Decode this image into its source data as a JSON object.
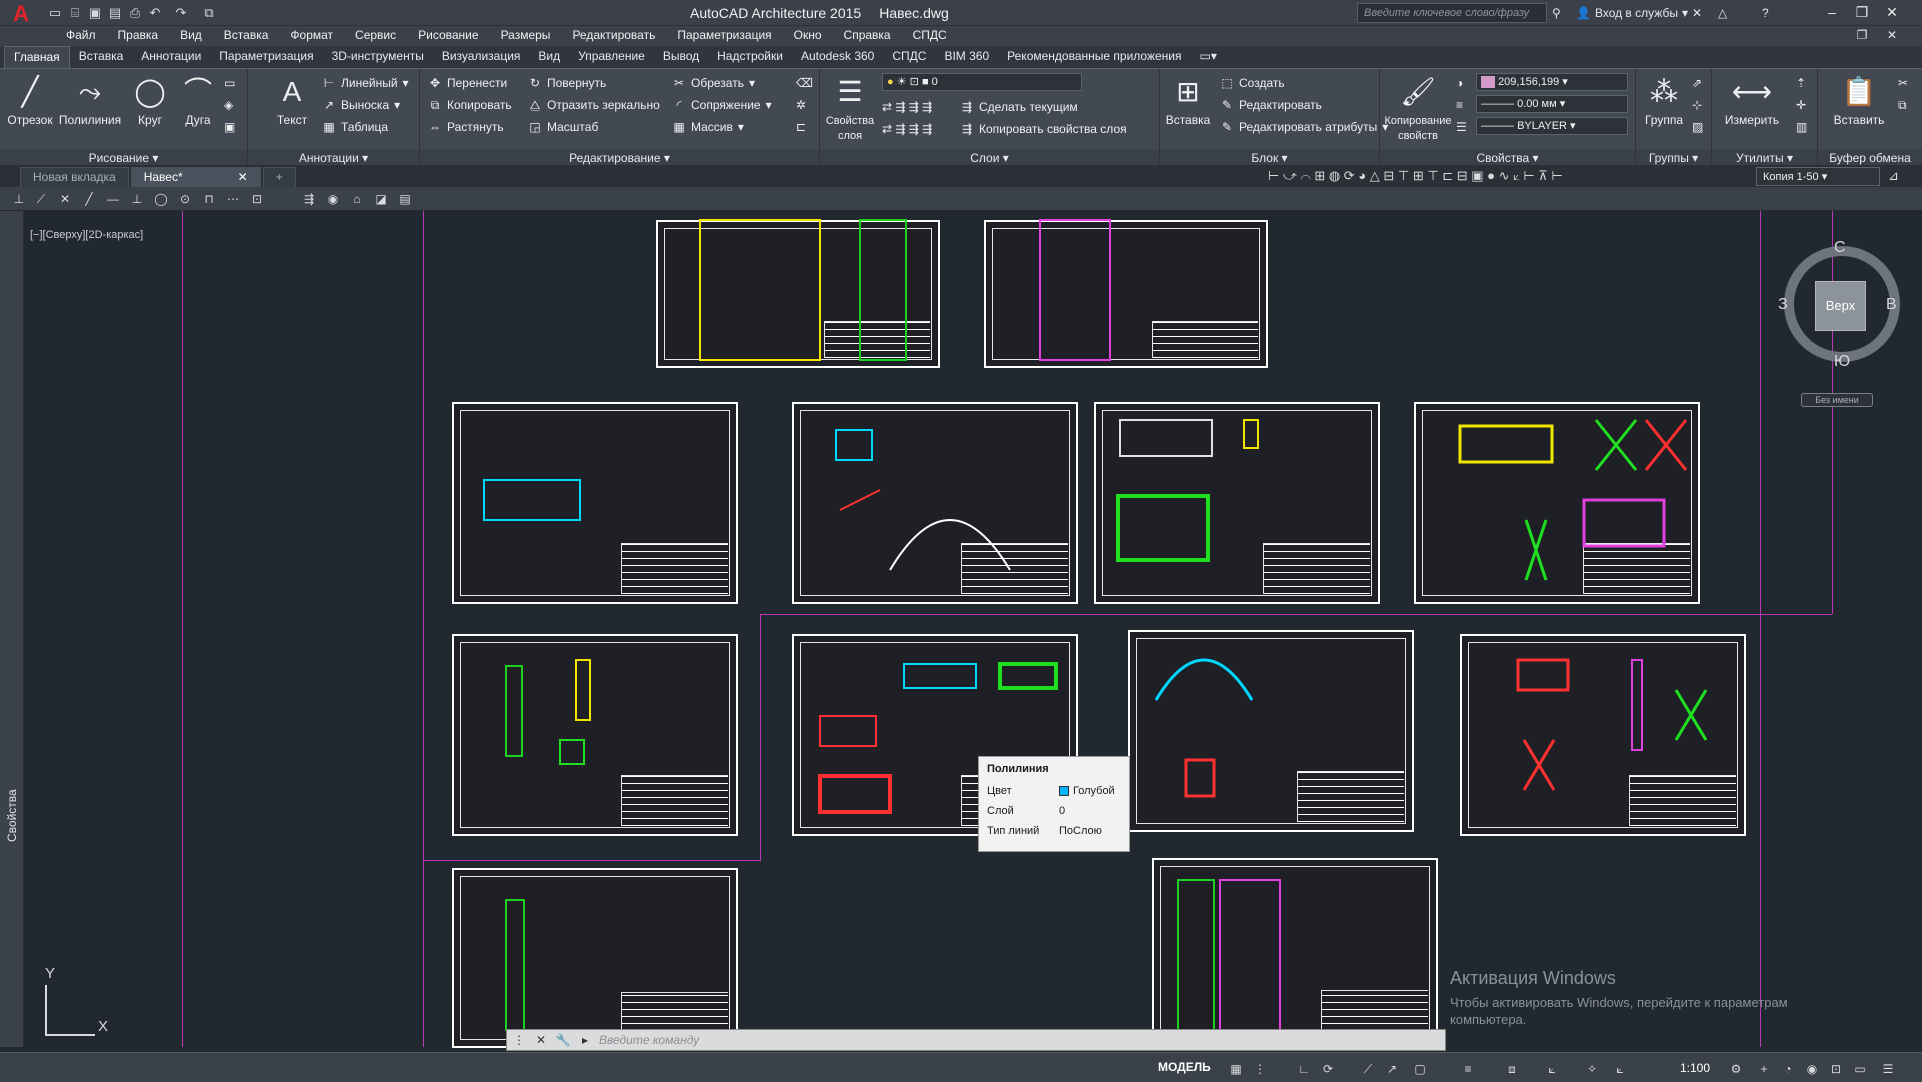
{
  "titlebar": {
    "app_title": "AutoCAD Architecture 2015",
    "file_name": "Навес.dwg",
    "search_placeholder": "Введите ключевое слово/фразу",
    "signin": "Вход в службы"
  },
  "menu": [
    "Файл",
    "Правка",
    "Вид",
    "Вставка",
    "Формат",
    "Сервис",
    "Рисование",
    "Размеры",
    "Редактировать",
    "Параметризация",
    "Окно",
    "Справка",
    "СПДС"
  ],
  "ribbon_tabs": [
    "Главная",
    "Вставка",
    "Аннотации",
    "Параметризация",
    "3D-инструменты",
    "Визуализация",
    "Вид",
    "Управление",
    "Вывод",
    "Надстройки",
    "Autodesk 360",
    "СПДС",
    "BIM 360",
    "Рекомендованные приложения"
  ],
  "ribbon": {
    "draw": {
      "title": "Рисование",
      "line": "Отрезок",
      "polyline": "Полилиния",
      "circle": "Круг",
      "arc": "Дуга"
    },
    "annotation": {
      "title": "Аннотации",
      "text": "Текст",
      "linear": "Линейный",
      "leader": "Выноска",
      "table": "Таблица"
    },
    "modify": {
      "title": "Редактирование",
      "move": "Перенести",
      "rotate": "Повернуть",
      "trim": "Обрезать",
      "copy": "Копировать",
      "mirror": "Отразить зеркально",
      "fillet": "Сопряжение",
      "stretch": "Растянуть",
      "scale": "Масштаб",
      "array": "Массив"
    },
    "layers": {
      "title": "Слои",
      "props": "Свойства слоя",
      "current_layer": "0",
      "make_current": "Сделать текущим",
      "copy_props": "Копировать свойства слоя"
    },
    "block": {
      "title": "Блок",
      "insert": "Вставка",
      "create": "Создать",
      "edit": "Редактировать",
      "edit_attr": "Редактировать атрибуты"
    },
    "properties": {
      "title": "Свойства",
      "match": "Копирование свойств",
      "color": "209,156,199",
      "lineweight": "0.00 мм",
      "linetype": "BYLAYER"
    },
    "groups": {
      "title": "Группы",
      "group": "Группа"
    },
    "utilities": {
      "title": "Утилиты",
      "measure": "Измерить"
    },
    "clipboard": {
      "title": "Буфер обмена",
      "paste": "Вставить"
    }
  },
  "doc_tabs": [
    "Новая вкладка",
    "Навес*"
  ],
  "toolbar": {
    "scale": "Копия 1-50"
  },
  "viewport_label": "[−][Сверху][2D-каркас]",
  "sidebar_label": "Свойства",
  "viewcube": {
    "face": "Верх",
    "north": "С",
    "south": "Ю",
    "east": "В",
    "west": "З",
    "ucs_name": "Без имени"
  },
  "tooltip": {
    "title": "Полилиния",
    "rows": [
      {
        "key": "Цвет",
        "value": "Голубой"
      },
      {
        "key": "Слой",
        "value": "0"
      },
      {
        "key": "Тип линий",
        "value": "ПоСлою"
      }
    ]
  },
  "watermark": {
    "title": "Активация Windows",
    "subtitle": "Чтобы активировать Windows, перейдите к параметрам компьютера."
  },
  "command": {
    "placeholder": "Введите команду"
  },
  "status": {
    "model": "МОДЕЛЬ",
    "scale": "1:100"
  },
  "ucs": {
    "x": "X",
    "y": "Y"
  },
  "colors": {
    "accent": "#e3232b",
    "magenta": "#c034b8",
    "cyan": "#00b4ff",
    "drawing_bg": "#212830"
  }
}
